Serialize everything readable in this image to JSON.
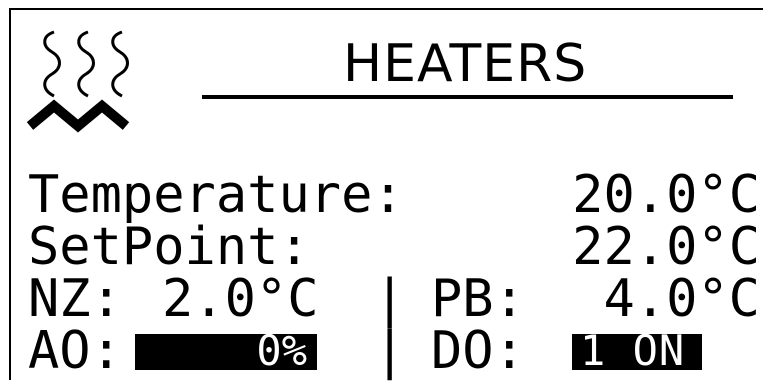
{
  "window": {
    "title": "HEATERS"
  },
  "icons": {
    "heater": "heater-icon"
  },
  "rows": {
    "temperature": {
      "label": "Temperature:",
      "value": "20.0°C"
    },
    "setpoint": {
      "label": "SetPoint:",
      "value": "22.0°C"
    },
    "nz_pb": {
      "nz_label": "NZ:",
      "nz_value": "2.0°C",
      "separator": "|",
      "pb_label": "PB:",
      "pb_value": "4.0°C"
    },
    "ao_do": {
      "ao_label": "AO:",
      "ao_value": "0%",
      "separator": "|",
      "do_label": "DO:",
      "do_value": "1 ON"
    }
  },
  "colors": {
    "background": "#ffffff",
    "foreground": "#000000"
  }
}
